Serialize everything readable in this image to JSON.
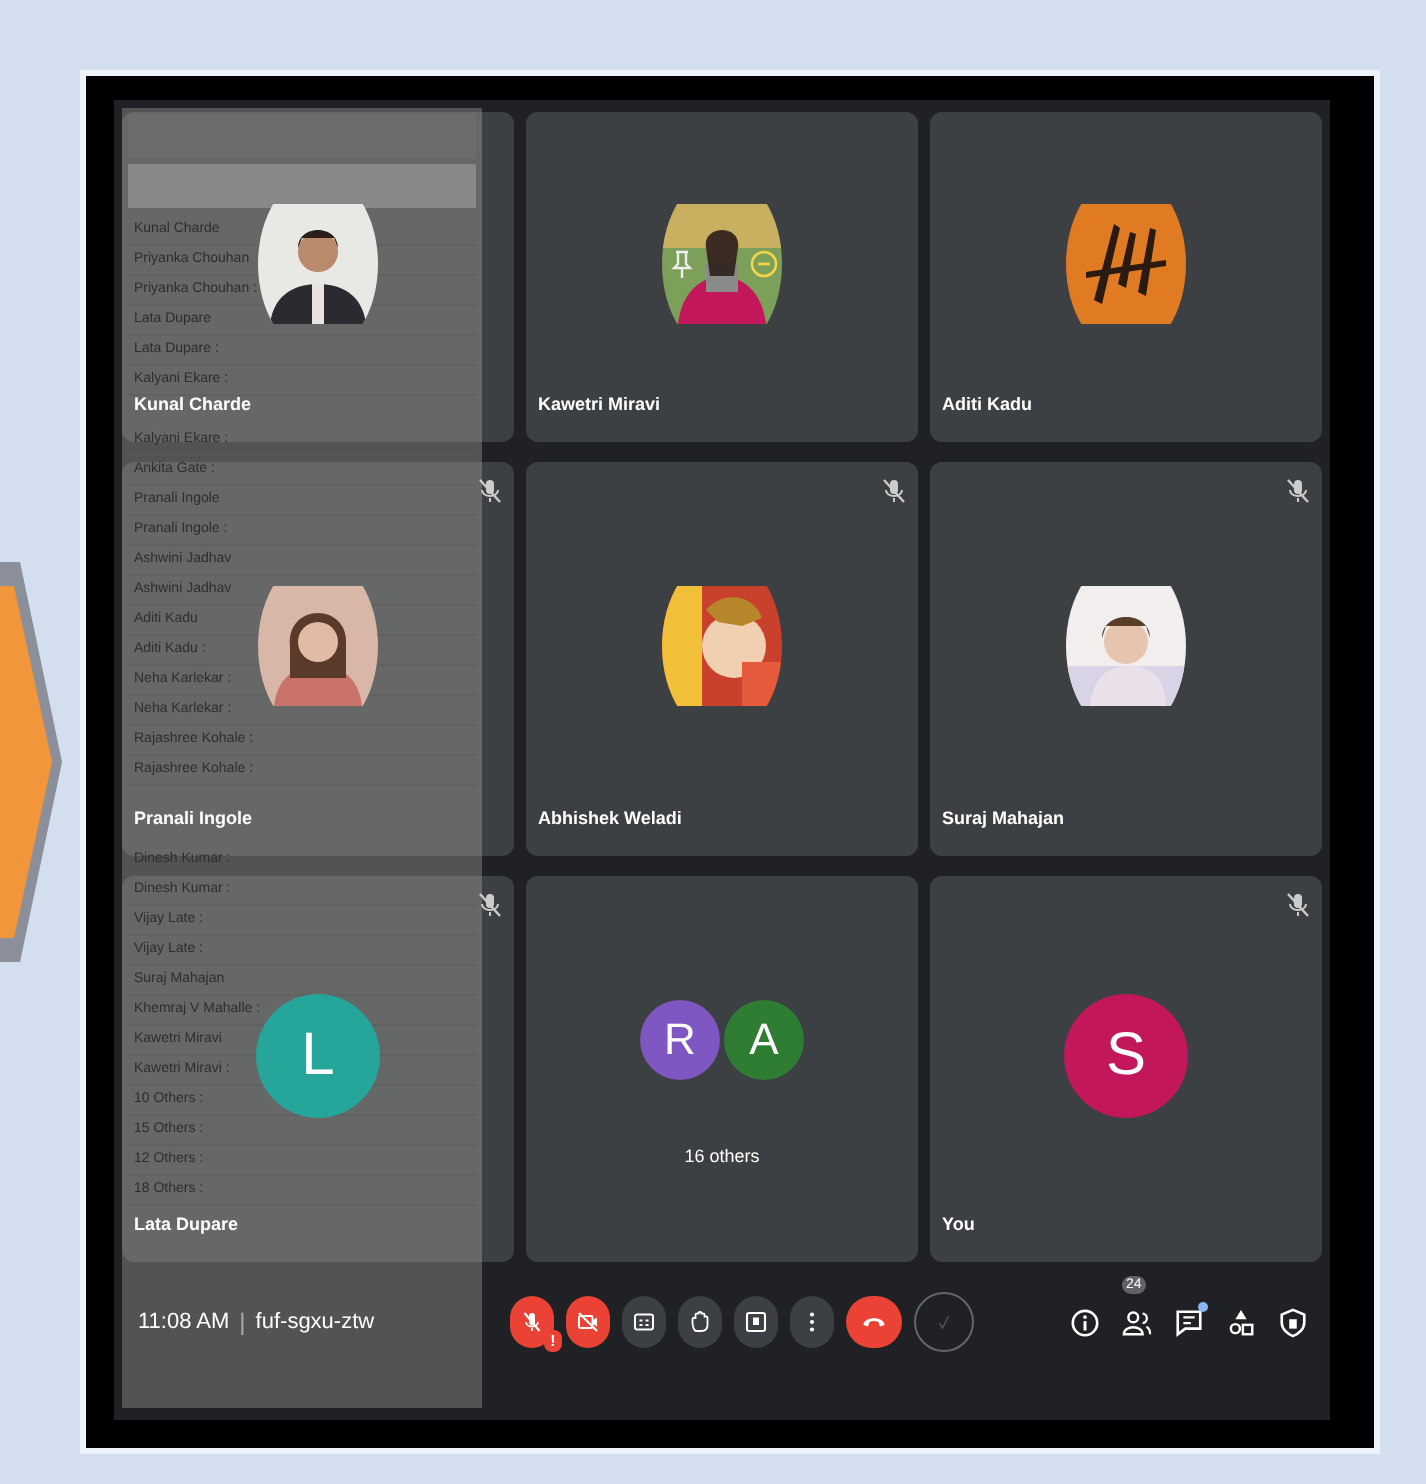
{
  "attendance_overlay": {
    "rows": [
      {
        "name": "Kunal Charde"
      },
      {
        "name": "Priyanka Chouhan"
      },
      {
        "name": "Priyanka Chouhan :"
      },
      {
        "name": "Lata Dupare"
      },
      {
        "name": "Lata Dupare :"
      },
      {
        "name": "Kalyani Ekare :"
      },
      {
        "name": "Kalyani Ekare :"
      },
      {
        "name": "Ankita Gate :"
      },
      {
        "name": "Pranali Ingole"
      },
      {
        "name": "Pranali Ingole :"
      },
      {
        "name": "Ashwini Jadhav"
      },
      {
        "name": "Ashwini Jadhav"
      },
      {
        "name": "Aditi Kadu"
      },
      {
        "name": "Aditi Kadu :"
      },
      {
        "name": "Neha Karlekar :"
      },
      {
        "name": "Neha Karlekar :"
      },
      {
        "name": "Rajashree Kohale :"
      },
      {
        "name": "Rajashree Kohale :"
      },
      {
        "name": "Dinesh Kumar :"
      },
      {
        "name": "Dinesh Kumar :"
      },
      {
        "name": "Vijay Late :"
      },
      {
        "name": "Vijay Late :"
      },
      {
        "name": "Suraj Mahajan"
      },
      {
        "name": "Khemraj V Mahalle :"
      },
      {
        "name": "Kawetri Miravi"
      },
      {
        "name": "Kawetri Miravi :"
      },
      {
        "name": "10 Others :"
      },
      {
        "name": "15 Others :"
      },
      {
        "name": "12 Others :"
      },
      {
        "name": "18 Others :"
      }
    ]
  },
  "tiles": [
    {
      "name": "Kunal Charde",
      "muted": false
    },
    {
      "name": "Kawetri Miravi",
      "muted": false,
      "hover_actions": true
    },
    {
      "name": "Aditi Kadu",
      "muted": false
    },
    {
      "name": "Pranali Ingole",
      "muted": true
    },
    {
      "name": "Abhishek Weladi",
      "muted": true
    },
    {
      "name": "Suraj Mahajan",
      "muted": true
    },
    {
      "name": "Lata Dupare",
      "muted": true,
      "avatar": {
        "kind": "letter",
        "letter": "L",
        "color": "#26a69a"
      }
    },
    {
      "name": "16 others",
      "muted": false,
      "avatar": {
        "kind": "group",
        "members": [
          {
            "letter": "R",
            "color": "#7e57c2"
          },
          {
            "letter": "A",
            "color": "#2e7d32"
          }
        ]
      }
    },
    {
      "name": "You",
      "muted": true,
      "avatar": {
        "kind": "letter",
        "letter": "S",
        "color": "#c2185b"
      }
    }
  ],
  "bottom_bar": {
    "time": "11:08 AM",
    "separator": "|",
    "meeting_code": "fuf-sgxu-ztw",
    "controls": [
      {
        "kind": "mic",
        "on": false,
        "alert": "!"
      },
      {
        "kind": "camera",
        "on": false
      },
      {
        "kind": "captions"
      },
      {
        "kind": "hand"
      },
      {
        "kind": "present"
      },
      {
        "kind": "more"
      },
      {
        "kind": "hangup"
      },
      {
        "kind": "check"
      }
    ],
    "side_controls": [
      {
        "kind": "info"
      },
      {
        "kind": "people",
        "badge": "24"
      },
      {
        "kind": "chat",
        "unread": true
      },
      {
        "kind": "activities"
      },
      {
        "kind": "host"
      }
    ]
  }
}
